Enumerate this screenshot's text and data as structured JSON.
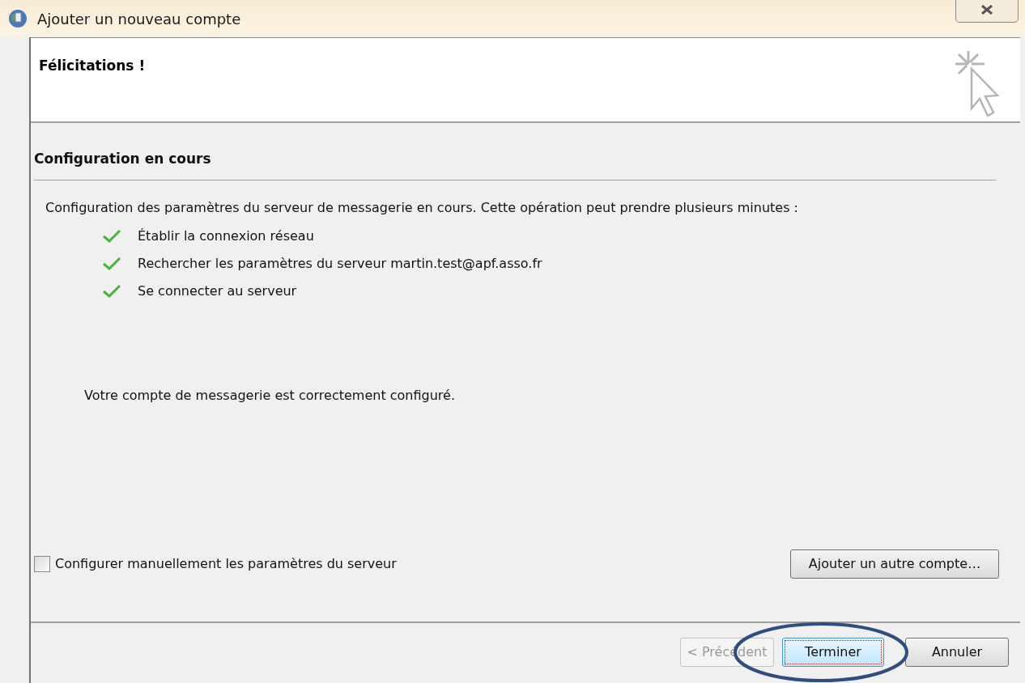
{
  "window": {
    "title": "Ajouter un nouveau compte"
  },
  "header": {
    "title": "Félicitations !"
  },
  "section": {
    "title": "Configuration en cours"
  },
  "intro": "Configuration des paramètres du serveur de messagerie en cours. Cette opération peut prendre plusieurs minutes :",
  "steps": [
    {
      "label": "Établir la connexion réseau",
      "done": true
    },
    {
      "label": "Rechercher les paramètres du serveur martin.test@apf.asso.fr",
      "done": true
    },
    {
      "label": "Se connecter au serveur",
      "done": true
    }
  ],
  "result": "Votre compte de messagerie est correctement configuré.",
  "manual_checkbox": {
    "label": "Configurer manuellement les paramètres du serveur",
    "checked": false
  },
  "add_account_button": "Ajouter un autre compte…",
  "buttons": [
    {
      "label": "< Précédent",
      "disabled": true,
      "focused": false
    },
    {
      "label": "Terminer",
      "disabled": false,
      "focused": true
    },
    {
      "label": "Annuler",
      "disabled": false,
      "focused": false
    }
  ]
}
